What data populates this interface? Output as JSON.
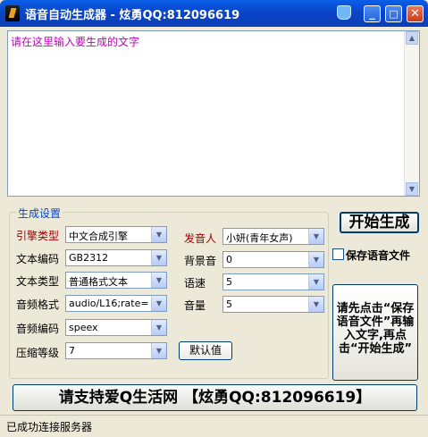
{
  "window": {
    "title": "语音自动生成器 - 炫勇QQ:812096619",
    "minimize": "_",
    "maximize": "□",
    "close": "✕"
  },
  "text_area": {
    "value": "请在这里输入要生成的文字"
  },
  "settings": {
    "group_title": "生成设置",
    "engine_type": {
      "label": "引擎类型",
      "value": "中文合成引擎"
    },
    "speaker": {
      "label": "发音人",
      "value": "小妍(青年女声)"
    },
    "text_encoding": {
      "label": "文本编码",
      "value": "GB2312"
    },
    "background_sound": {
      "label": "背景音",
      "value": "0"
    },
    "text_type": {
      "label": "文本类型",
      "value": "普通格式文本"
    },
    "speed": {
      "label": "语速",
      "value": "5"
    },
    "audio_format": {
      "label": "音频格式",
      "value": "audio/L16;rate="
    },
    "volume": {
      "label": "音量",
      "value": "5"
    },
    "audio_codec": {
      "label": "音频编码",
      "value": "speex"
    },
    "compression": {
      "label": "压缩等级",
      "value": "7"
    },
    "default_button": "默认值"
  },
  "actions": {
    "start_button": "开始生成",
    "save_audio_checkbox": "保存语音文件",
    "instruction_button": "请先点击“保存语音文件”再输入文字,再点击“开始生成”",
    "support_button": "请支持爱Q生活网 【炫勇QQ:812096619】"
  },
  "status_bar": {
    "text": "已成功连接服务器"
  },
  "icons": {
    "app": "app-logo-icon",
    "skin": "gem-icon",
    "dropdown": "chevron-down-icon"
  },
  "colors": {
    "titlebar": "#0a44c8",
    "prompt_text": "#c000c0",
    "group_title": "#0046d5",
    "required_label": "#a00000"
  }
}
